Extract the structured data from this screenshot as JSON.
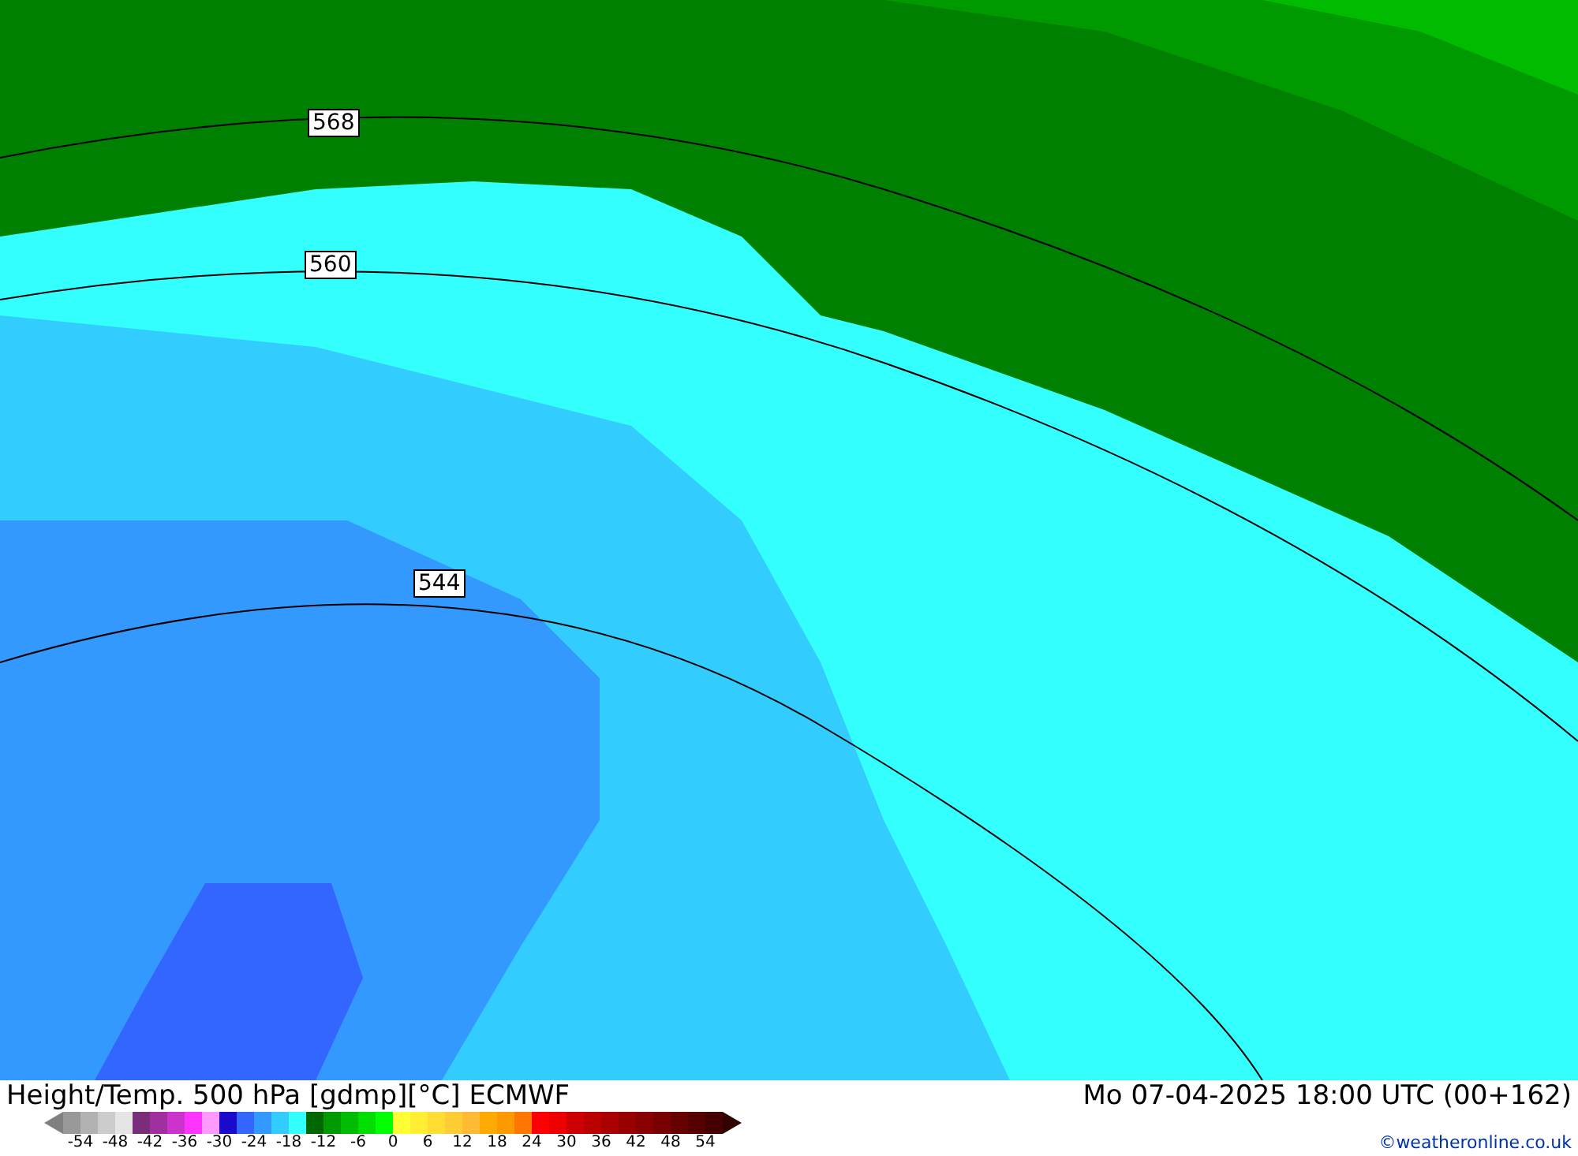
{
  "map": {
    "contour_labels": [
      "568",
      "560",
      "544"
    ]
  },
  "footer": {
    "title": "Height/Temp. 500 hPa [gdmp][°C] ECMWF",
    "datetime": "Mo 07-04-2025 18:00 UTC (00+162)",
    "copyright": "©weatheronline.co.uk"
  },
  "legend": {
    "ends": [
      {
        "kind": "low",
        "color": "#808080"
      },
      {
        "kind": "high",
        "color": "#330000"
      }
    ],
    "swatches": [
      {
        "color": "#999999"
      },
      {
        "color": "#b2b2b2"
      },
      {
        "color": "#cccccc"
      },
      {
        "color": "#e5e5e5"
      },
      {
        "color": "#7a2d7a"
      },
      {
        "color": "#a030a0"
      },
      {
        "color": "#cc33cc"
      },
      {
        "color": "#ff33ff"
      },
      {
        "color": "#ff99ff"
      },
      {
        "color": "#1a0acc"
      },
      {
        "color": "#3366ff"
      },
      {
        "color": "#3399ff"
      },
      {
        "color": "#33ccff"
      },
      {
        "color": "#33ffff"
      },
      {
        "color": "#006600"
      },
      {
        "color": "#009900"
      },
      {
        "color": "#00bb00"
      },
      {
        "color": "#00dd00"
      },
      {
        "color": "#00ff00"
      },
      {
        "color": "#ffff33"
      },
      {
        "color": "#ffee33"
      },
      {
        "color": "#ffdd33"
      },
      {
        "color": "#ffcc33"
      },
      {
        "color": "#ffbb33"
      },
      {
        "color": "#ffaa00"
      },
      {
        "color": "#ff9900"
      },
      {
        "color": "#ff7700"
      },
      {
        "color": "#ff0000"
      },
      {
        "color": "#ee0000"
      },
      {
        "color": "#cc0000"
      },
      {
        "color": "#bb0000"
      },
      {
        "color": "#aa0000"
      },
      {
        "color": "#990000"
      },
      {
        "color": "#880000"
      },
      {
        "color": "#770000"
      },
      {
        "color": "#660000"
      },
      {
        "color": "#550000"
      },
      {
        "color": "#440000"
      }
    ],
    "ticks": [
      "-54",
      "-48",
      "-42",
      "-36",
      "-30",
      "-24",
      "-18",
      "-12",
      "-6",
      "0",
      "6",
      "12",
      "18",
      "24",
      "30",
      "36",
      "42",
      "48",
      "54"
    ]
  }
}
